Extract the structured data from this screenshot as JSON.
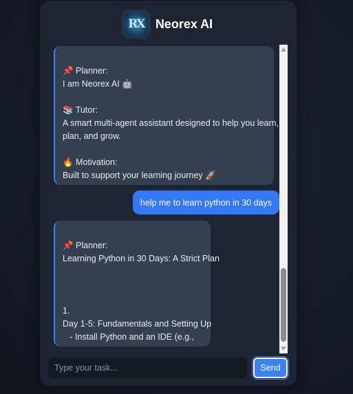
{
  "app": {
    "title": "Neorex AI",
    "logo_text": "RX"
  },
  "messages": [
    {
      "role": "bot",
      "lines": [
        "📌 Planner:",
        "I am Neorex AI 🤖",
        "",
        "📚 Tutor:",
        "A smart multi-agent assistant designed to help you learn,",
        "plan, and grow.",
        "",
        "🔥 Motivation:",
        "Built to support your learning journey 🚀"
      ]
    },
    {
      "role": "user",
      "text": "help me to learn python in 30 days"
    },
    {
      "role": "bot",
      "lines": [
        "📌 Planner:",
        "Learning Python in 30 Days: A Strict Plan",
        "",
        "",
        "",
        "1.",
        "Day 1-5: Fundamentals and Setting Up",
        "   - Install Python and an IDE (e.g.,"
      ]
    }
  ],
  "input": {
    "placeholder": "Type your task...",
    "value": ""
  },
  "send_label": "Send",
  "colors": {
    "accent": "#3b82f6",
    "card": "#1e2532",
    "bot_bubble": "#343f4f",
    "user_bubble": "#3478f6"
  }
}
